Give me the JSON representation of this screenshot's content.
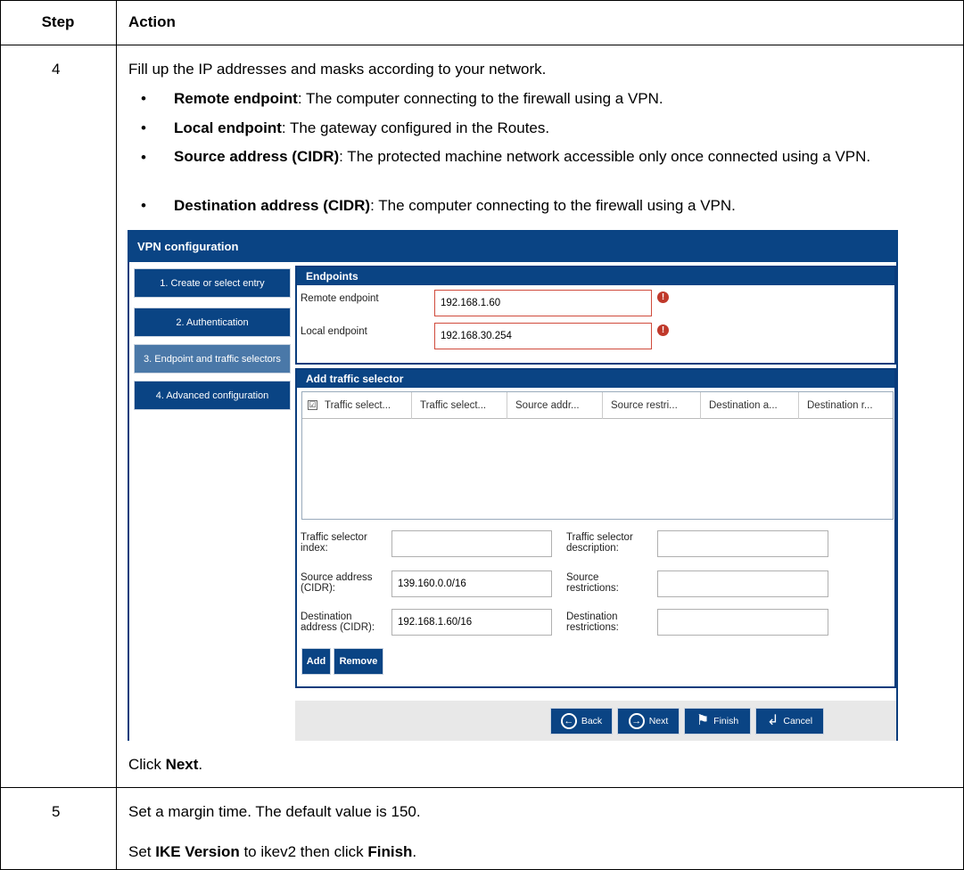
{
  "table": {
    "headers": {
      "step": "Step",
      "action": "Action"
    },
    "row4": {
      "step": "4",
      "intro": "Fill up the IP addresses and masks according to your network.",
      "bullets": [
        {
          "term": "Remote endpoint",
          "desc": ": The computer connecting to the firewall using a VPN."
        },
        {
          "term": "Local endpoint",
          "desc": ": The gateway configured in the Routes."
        },
        {
          "term": "Source address (CIDR)",
          "desc": ": The protected machine network accessible only once connected using a VPN."
        },
        {
          "term": "Destination address (CIDR)",
          "desc": ": The computer connecting to the firewall using a VPN."
        }
      ],
      "click_prefix": "Click ",
      "click_term": "Next",
      "click_suffix": "."
    },
    "row5": {
      "step": "5",
      "line1": "Set a margin time. The default value is 150.",
      "line2_prefix": "Set ",
      "line2_term1": "IKE Version",
      "line2_mid": " to ikev2 then click ",
      "line2_term2": "Finish",
      "line2_suffix": "."
    }
  },
  "vpn": {
    "title": "VPN configuration",
    "nav": [
      {
        "label": "1. Create or select entry"
      },
      {
        "label": "2. Authentication"
      },
      {
        "label": "3. Endpoint and traffic selectors"
      },
      {
        "label": "4. Advanced configuration"
      }
    ],
    "endpoints": {
      "heading": "Endpoints",
      "remote_label": "Remote endpoint",
      "remote_value": "192.168.1.60",
      "local_label": "Local endpoint",
      "local_value": "192.168.30.254",
      "error_icon": "!"
    },
    "traffic": {
      "heading": "Add traffic selector",
      "columns": [
        "Traffic select...",
        "Traffic select...",
        "Source addr...",
        "Source restri...",
        "Destination a...",
        "Destination r..."
      ],
      "checkbox_glyph": "☑",
      "fields": {
        "index_label": "Traffic selector index:",
        "index_value": "",
        "desc_label": "Traffic selector description:",
        "desc_value": "",
        "src_label": "Source address (CIDR):",
        "src_value": "139.160.0.0/16",
        "srcres_label": "Source restrictions:",
        "srcres_value": "",
        "dst_label": "Destination address (CIDR):",
        "dst_value": "192.168.1.60/16",
        "dstres_label": "Destination restrictions:",
        "dstres_value": ""
      },
      "add_label": "Add",
      "remove_label": "Remove"
    },
    "footer": {
      "back": "Back",
      "next": "Next",
      "finish": "Finish",
      "cancel": "Cancel"
    }
  }
}
